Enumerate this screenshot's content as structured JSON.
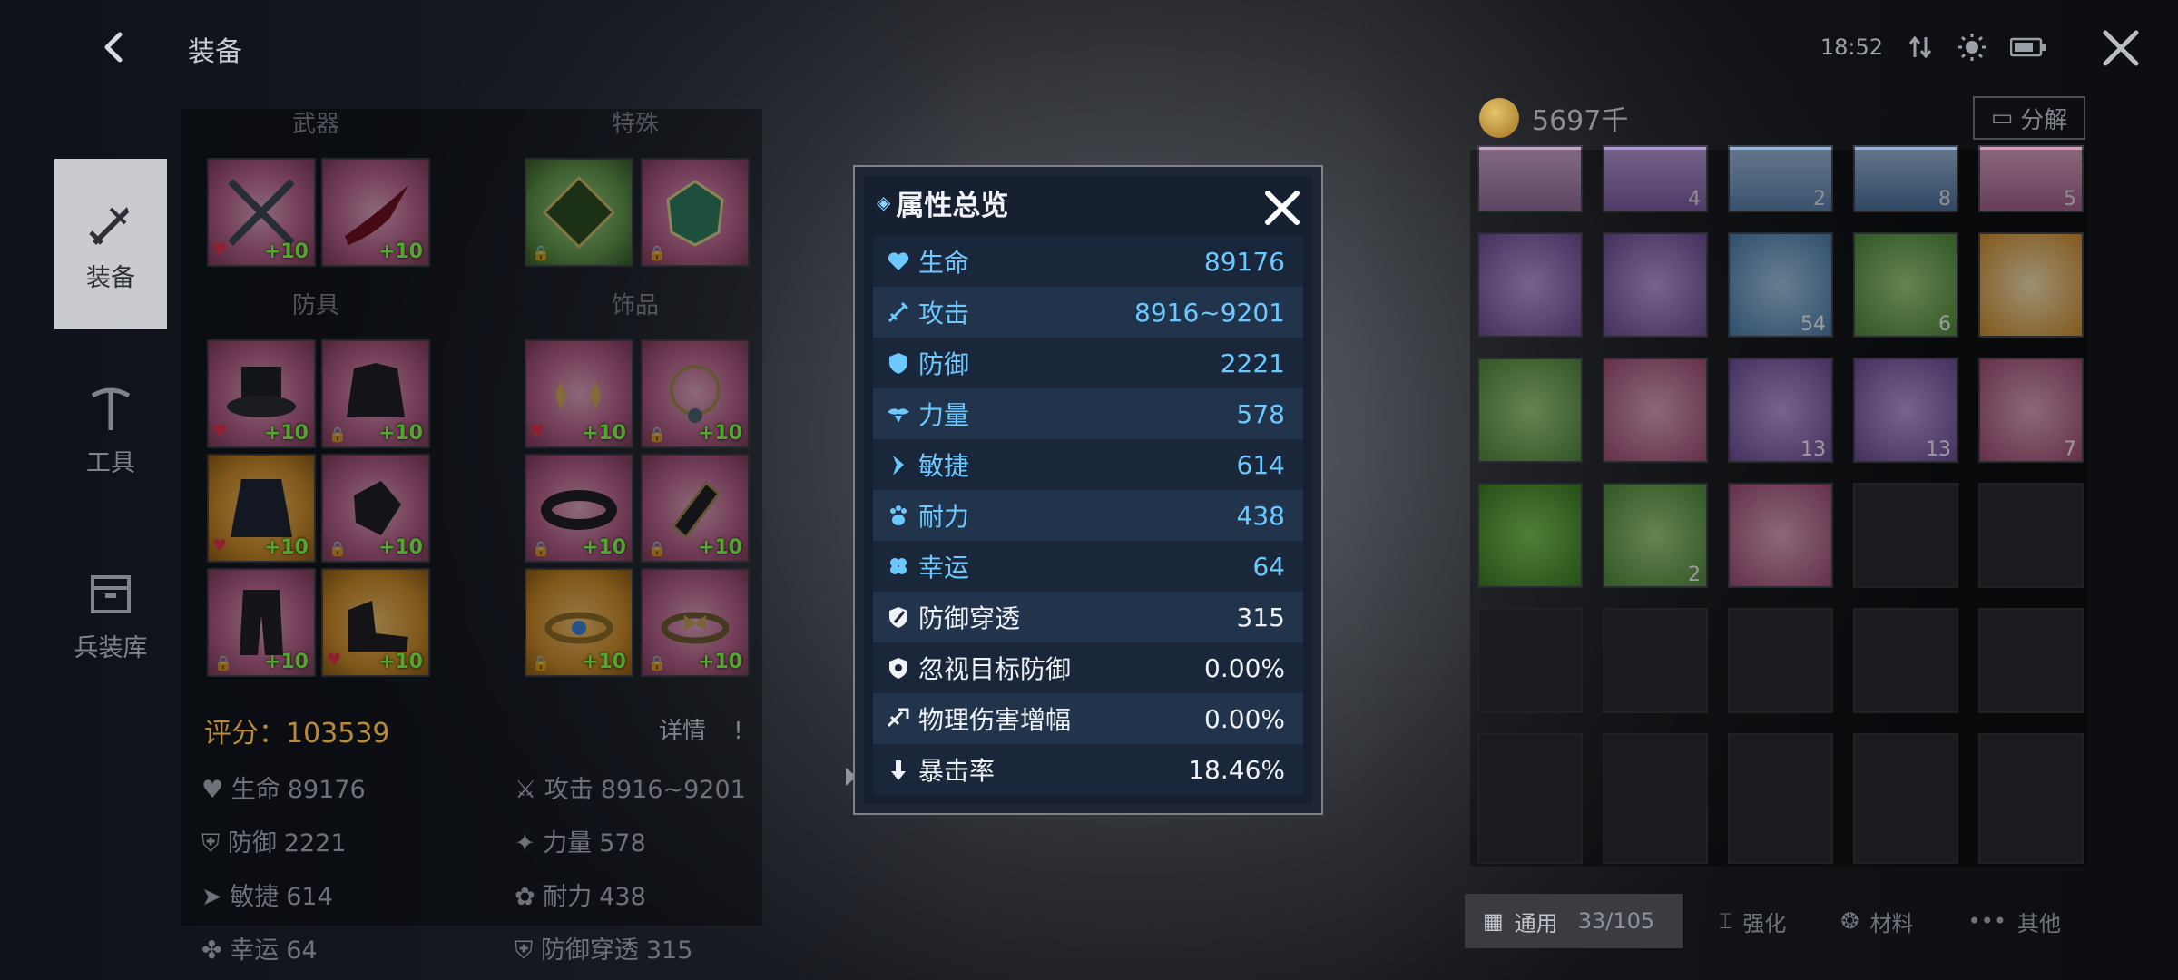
{
  "header": {
    "title": "装备",
    "time": "18:52"
  },
  "nav": [
    {
      "label": "装备",
      "icon": "sword-icon",
      "active": true
    },
    {
      "label": "工具",
      "icon": "pickaxe-icon",
      "active": false
    },
    {
      "label": "兵装库",
      "icon": "storage-box-icon",
      "active": false
    }
  ],
  "equipment": {
    "sections": {
      "weapon": "武器",
      "special": "特殊",
      "armor": "防具",
      "accessory": "饰品"
    },
    "score_label": "评分：",
    "score_value": "103539",
    "detail_label": "详情",
    "enhance_tag": "+10"
  },
  "summary_stats": [
    {
      "label": "生命",
      "value": "89176"
    },
    {
      "label": "攻击",
      "value": "8916~9201"
    },
    {
      "label": "防御",
      "value": "2221"
    },
    {
      "label": "力量",
      "value": "578"
    },
    {
      "label": "敏捷",
      "value": "614"
    },
    {
      "label": "耐力",
      "value": "438"
    },
    {
      "label": "幸运",
      "value": "64"
    },
    {
      "label": "防御穿透",
      "value": "315"
    }
  ],
  "inventory": {
    "currency": "5697千",
    "split_label": "分解",
    "quantities": [
      "4",
      "2",
      "8",
      "5",
      "54",
      "6",
      "13",
      "13",
      "7",
      "2"
    ],
    "tabs": [
      {
        "label": "通用",
        "count": "33/105",
        "active": true
      },
      {
        "label": "强化",
        "active": false
      },
      {
        "label": "材料",
        "active": false
      },
      {
        "label": "其他",
        "active": false
      }
    ]
  },
  "modal": {
    "title": "属性总览",
    "rows": [
      {
        "label": "生命",
        "value": "89176",
        "style": "blue",
        "icon": "heart-icon"
      },
      {
        "label": "攻击",
        "value": "8916~9201",
        "style": "blue",
        "icon": "attack-icon"
      },
      {
        "label": "防御",
        "value": "2221",
        "style": "blue",
        "icon": "shield-icon"
      },
      {
        "label": "力量",
        "value": "578",
        "style": "blue",
        "icon": "muscle-icon"
      },
      {
        "label": "敏捷",
        "value": "614",
        "style": "blue",
        "icon": "boot-icon"
      },
      {
        "label": "耐力",
        "value": "438",
        "style": "blue",
        "icon": "paw-icon"
      },
      {
        "label": "幸运",
        "value": "64",
        "style": "blue",
        "icon": "clover-icon"
      },
      {
        "label": "防御穿透",
        "value": "315",
        "style": "white",
        "icon": "pierce-shield-icon"
      },
      {
        "label": "忽视目标防御",
        "value": "0.00%",
        "style": "white",
        "icon": "ignore-shield-icon"
      },
      {
        "label": "物理伤害增幅",
        "value": "0.00%",
        "style": "white",
        "icon": "damage-boost-icon"
      },
      {
        "label": "暴击率",
        "value": "18.46%",
        "style": "white",
        "icon": "crit-icon"
      }
    ]
  },
  "colors": {
    "accent_blue": "#6cc8ff",
    "score_gold": "#b88a3a",
    "enhance_green": "#7dff4a"
  }
}
